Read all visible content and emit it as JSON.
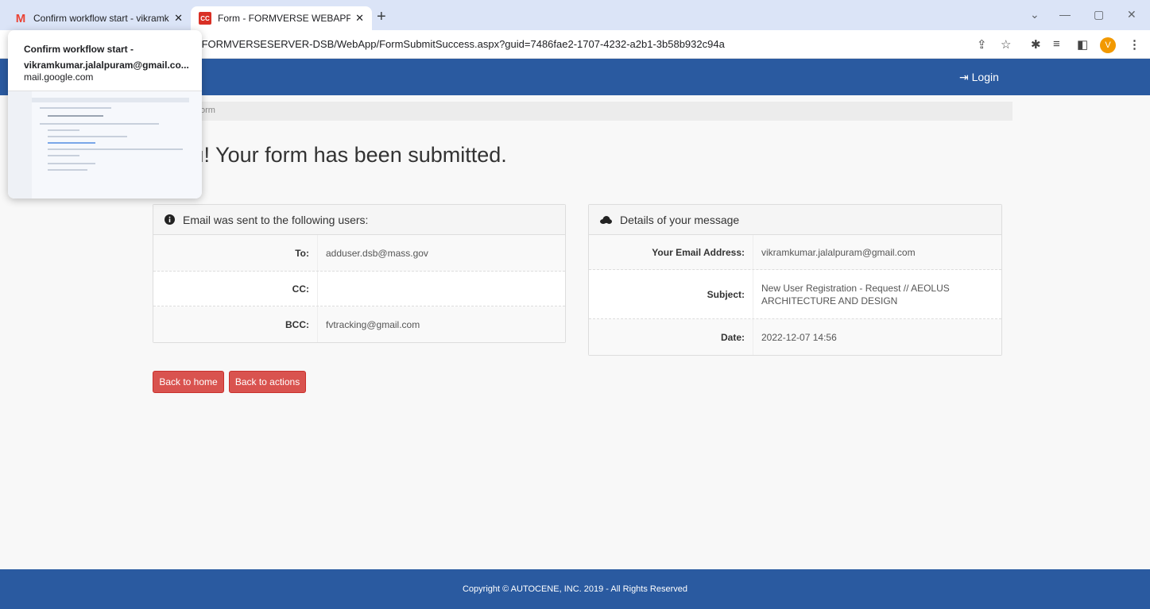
{
  "browser": {
    "tabs": [
      {
        "title": "Confirm workflow start - vikramk",
        "favicon": "gmail-icon",
        "active": false
      },
      {
        "title": "Form - FORMVERSE WEBAPP",
        "favicon": "formverse-icon",
        "active": true
      }
    ],
    "url": "/FORMVERSESERVER-DSB/WebApp/FormSubmitSuccess.aspx?guid=7486fae2-1707-4232-a2b1-3b58b932c94a",
    "profile_initial": "V"
  },
  "hovercard": {
    "title": "Confirm workflow start - vikramkumar.jalalpuram@gmail.co...",
    "domain": "mail.google.com"
  },
  "nav": {
    "login_label": "Login"
  },
  "breadcrumb": {
    "text": "orm"
  },
  "heading": "k you! Your form has been submitted.",
  "email_panel": {
    "title": "Email was sent to the following users:",
    "rows": [
      {
        "label": "To:",
        "value": "adduser.dsb@mass.gov"
      },
      {
        "label": "CC:",
        "value": ""
      },
      {
        "label": "BCC:",
        "value": "fvtracking@gmail.com"
      }
    ]
  },
  "details_panel": {
    "title": "Details of your message",
    "rows": [
      {
        "label": "Your Email Address:",
        "value": "vikramkumar.jalalpuram@gmail.com"
      },
      {
        "label": "Subject:",
        "value": "New User Registration - Request // AEOLUS ARCHITECTURE AND DESIGN"
      },
      {
        "label": "Date:",
        "value": "2022-12-07 14:56"
      }
    ]
  },
  "buttons": {
    "back_home": "Back to home",
    "back_actions": "Back to actions"
  },
  "footer": {
    "text": "Copyright © AUTOCENE, INC. 2019 - All Rights Reserved"
  },
  "colors": {
    "nav": "#2a5aa0",
    "button": "#d9534f",
    "tabstrip": "#dbe4f7"
  }
}
